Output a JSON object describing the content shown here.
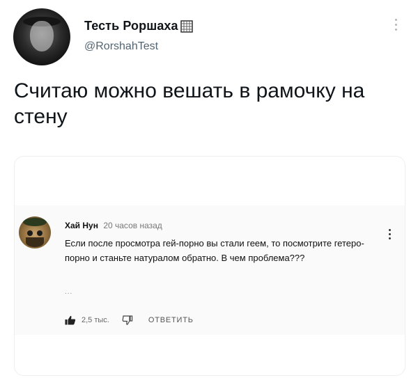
{
  "author": {
    "name": "Тесть Роршаха",
    "handle": "@RorshahTest"
  },
  "tweet": {
    "text": "Считаю можно вешать в рамочку на стену"
  },
  "embedded_comment": {
    "author": "Хай Нун",
    "time": "20 часов назад",
    "text": "Если после просмотра гей-порно вы стали геем, то посмотрите гетеро-порно и станьте натуралом обратно. В чем проблема???",
    "ellipsis": "...",
    "likes": "2,5 тыс.",
    "reply_label": "ОТВЕТИТЬ"
  },
  "icons": {
    "flag": "waffle-flag-icon",
    "more": "more-icon",
    "like": "thumbs-up-icon",
    "dislike": "thumbs-down-icon"
  }
}
